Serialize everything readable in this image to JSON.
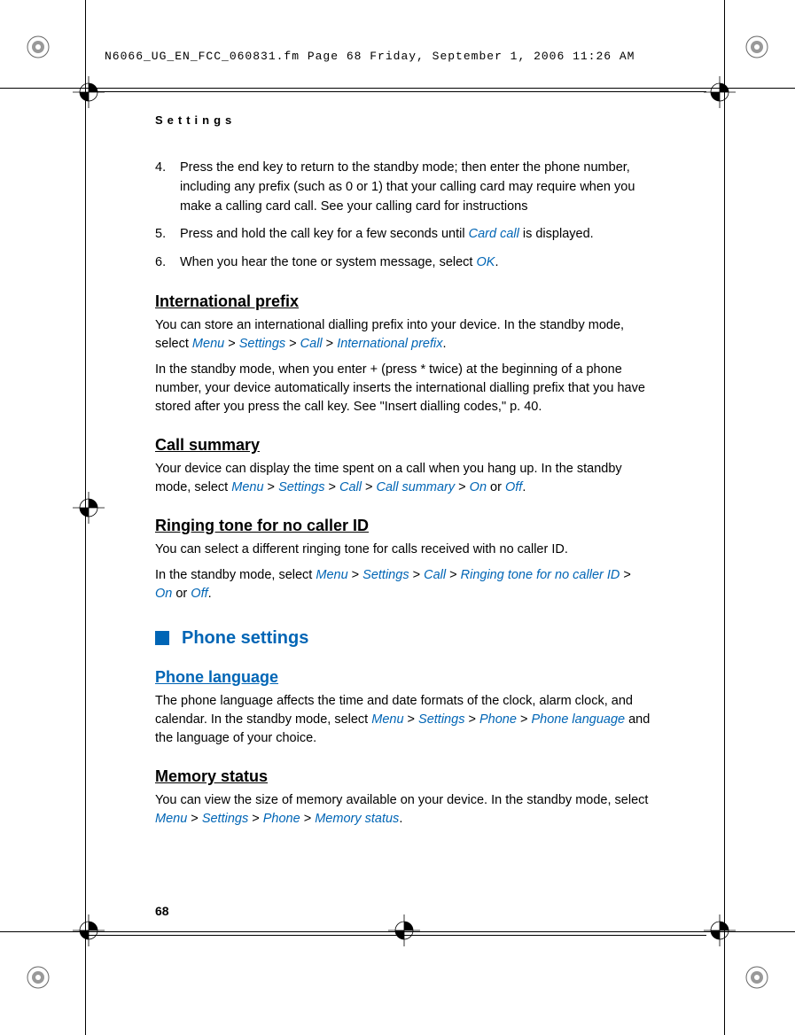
{
  "header": {
    "text": "N6066_UG_EN_FCC_060831.fm  Page 68  Friday, September 1, 2006  11:26 AM"
  },
  "sectionLabel": "Settings",
  "steps": [
    {
      "num": "4.",
      "text_before": "Press the end key to return to the standby mode; then enter the phone number, including any prefix (such as 0 or 1) that your calling card may require when you make a calling card call. See your calling card for instructions",
      "accent": "",
      "text_after": ""
    },
    {
      "num": "5.",
      "text_before": "Press and hold the call key for a few seconds until ",
      "accent": "Card call",
      "text_after": " is displayed."
    },
    {
      "num": "6.",
      "text_before": "When you hear the tone or system message, select ",
      "accent": "OK",
      "text_after": "."
    }
  ],
  "intlPrefix": {
    "title": "International prefix",
    "p1_before": "You can store an international dialling prefix into your device. In the standby mode, select ",
    "p1_menu": "Menu",
    "p1_gt1": " > ",
    "p1_settings": "Settings",
    "p1_gt2": " > ",
    "p1_call": "Call",
    "p1_gt3": " > ",
    "p1_intl": "International prefix",
    "p1_after": ".",
    "p2": "In the standby mode, when you enter + (press * twice) at the beginning of a phone number, your device automatically inserts the international dialling prefix that you have stored after you press the call key. See \"Insert dialling codes,\" p. 40."
  },
  "callSummary": {
    "title": "Call summary",
    "p1_before": "Your device can display the time spent on a call when you hang up. In the standby mode, select ",
    "p1_menu": "Menu",
    "p1_gt1": " > ",
    "p1_settings": "Settings",
    "p1_gt2": " > ",
    "p1_call": "Call",
    "p1_gt3": " > ",
    "p1_cs": "Call summary",
    "p1_gt4": " > ",
    "p1_on": "On",
    "p1_or": " or ",
    "p1_off": "Off",
    "p1_after": "."
  },
  "ringingTone": {
    "title": "Ringing tone for no caller ID",
    "p1": "You can select a different ringing tone for calls received with no caller ID.",
    "p2_before": "In the standby mode, select ",
    "p2_menu": "Menu",
    "p2_gt1": " > ",
    "p2_settings": "Settings",
    "p2_gt2": " > ",
    "p2_call": "Call",
    "p2_gt3": " > ",
    "p2_rt": "Ringing tone for no caller ID",
    "p2_gt4": " > ",
    "p2_on": "On",
    "p2_or": " or ",
    "p2_off": "Off",
    "p2_after": "."
  },
  "phoneSettings": {
    "title": "Phone settings"
  },
  "phoneLang": {
    "title": "Phone language",
    "p1_before": "The phone language affects the time and date formats of the clock, alarm clock, and calendar. In the standby mode, select ",
    "p1_menu": "Menu",
    "p1_gt1": " > ",
    "p1_settings": "Settings",
    "p1_gt2": " > ",
    "p1_phone": "Phone",
    "p1_gt3": " > ",
    "p1_pl": "Phone language",
    "p1_after": " and the language of your choice."
  },
  "memoryStatus": {
    "title": "Memory status",
    "p1_before": "You can view the size of memory available on your device. In the standby mode, select ",
    "p1_menu": "Menu",
    "p1_gt1": " > ",
    "p1_settings": "Settings",
    "p1_gt2": " > ",
    "p1_phone": "Phone",
    "p1_gt3": " > ",
    "p1_ms": "Memory status",
    "p1_after": "."
  },
  "pageNumber": "68"
}
